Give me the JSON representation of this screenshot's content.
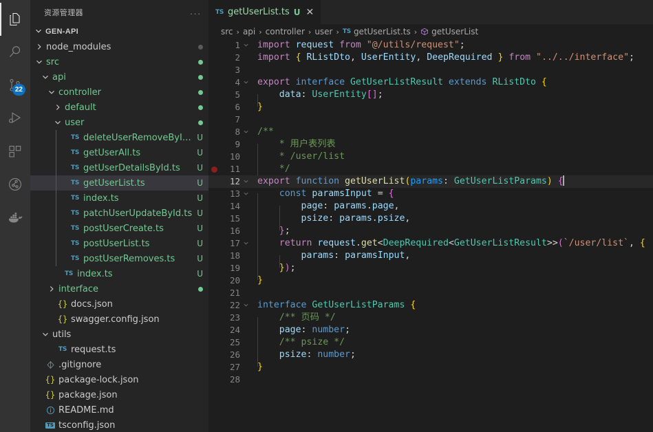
{
  "activitybar": {
    "items": [
      {
        "name": "explorer",
        "icon": "files-icon",
        "active": true,
        "badge": ""
      },
      {
        "name": "search",
        "icon": "search-icon",
        "active": false,
        "badge": ""
      },
      {
        "name": "source-control",
        "icon": "source-control-icon",
        "active": false,
        "badge": "22"
      },
      {
        "name": "run-debug",
        "icon": "run-and-debug-icon",
        "active": false,
        "badge": ""
      },
      {
        "name": "extensions",
        "icon": "extensions-icon",
        "active": false,
        "badge": ""
      },
      {
        "name": "git-graph",
        "icon": "git-graph-icon",
        "active": false,
        "badge": ""
      },
      {
        "name": "docker",
        "icon": "docker-icon",
        "active": false,
        "badge": ""
      }
    ]
  },
  "sidebar": {
    "title": "资源管理器",
    "more_actions": "...",
    "root": {
      "label": "GEN-API",
      "expanded": true
    },
    "tree": [
      {
        "label": "node_modules",
        "type": "folder",
        "expanded": false,
        "indent": 1,
        "deco": "dot",
        "deco_color": "#5a5a5a",
        "color": "#cccccc"
      },
      {
        "label": "src",
        "type": "folder",
        "expanded": true,
        "indent": 1,
        "deco": "dot",
        "deco_color": "#73c991",
        "color": "#73c991"
      },
      {
        "label": "api",
        "type": "folder",
        "expanded": true,
        "indent": 2,
        "deco": "dot",
        "deco_color": "#73c991",
        "color": "#73c991"
      },
      {
        "label": "controller",
        "type": "folder",
        "expanded": true,
        "indent": 3,
        "deco": "dot",
        "deco_color": "#73c991",
        "color": "#73c991"
      },
      {
        "label": "default",
        "type": "folder",
        "expanded": false,
        "indent": 4,
        "deco": "dot",
        "deco_color": "#73c991",
        "color": "#73c991"
      },
      {
        "label": "user",
        "type": "folder",
        "expanded": true,
        "indent": 4,
        "deco": "dot",
        "deco_color": "#73c991",
        "color": "#73c991"
      },
      {
        "label": "deleteUserRemoveById.ts",
        "type": "ts",
        "indent": 5,
        "deco": "U",
        "deco_color": "#73c991",
        "color": "#73c991"
      },
      {
        "label": "getUserAll.ts",
        "type": "ts",
        "indent": 5,
        "deco": "U",
        "deco_color": "#73c991",
        "color": "#73c991"
      },
      {
        "label": "getUserDetailsById.ts",
        "type": "ts",
        "indent": 5,
        "deco": "U",
        "deco_color": "#73c991",
        "color": "#73c991"
      },
      {
        "label": "getUserList.ts",
        "type": "ts",
        "indent": 5,
        "deco": "U",
        "deco_color": "#73c991",
        "color": "#73c991",
        "selected": true
      },
      {
        "label": "index.ts",
        "type": "ts",
        "indent": 5,
        "deco": "U",
        "deco_color": "#73c991",
        "color": "#73c991"
      },
      {
        "label": "patchUserUpdateById.ts",
        "type": "ts",
        "indent": 5,
        "deco": "U",
        "deco_color": "#73c991",
        "color": "#73c991"
      },
      {
        "label": "postUserCreate.ts",
        "type": "ts",
        "indent": 5,
        "deco": "U",
        "deco_color": "#73c991",
        "color": "#73c991"
      },
      {
        "label": "postUserList.ts",
        "type": "ts",
        "indent": 5,
        "deco": "U",
        "deco_color": "#73c991",
        "color": "#73c991"
      },
      {
        "label": "postUserRemoves.ts",
        "type": "ts",
        "indent": 5,
        "deco": "U",
        "deco_color": "#73c991",
        "color": "#73c991"
      },
      {
        "label": "index.ts",
        "type": "ts",
        "indent": 4,
        "deco": "U",
        "deco_color": "#73c991",
        "color": "#73c991"
      },
      {
        "label": "interface",
        "type": "folder",
        "expanded": false,
        "indent": 3,
        "deco": "dot",
        "deco_color": "#73c991",
        "color": "#73c991"
      },
      {
        "label": "docs.json",
        "type": "json",
        "indent": 3,
        "deco": "",
        "deco_color": "",
        "color": "#cccccc"
      },
      {
        "label": "swagger.config.json",
        "type": "json",
        "indent": 3,
        "deco": "",
        "deco_color": "",
        "color": "#cccccc"
      },
      {
        "label": "utils",
        "type": "folder",
        "expanded": true,
        "indent": 2,
        "deco": "",
        "deco_color": "",
        "color": "#cccccc"
      },
      {
        "label": "request.ts",
        "type": "ts",
        "indent": 3,
        "deco": "",
        "deco_color": "",
        "color": "#cccccc"
      },
      {
        "label": ".gitignore",
        "type": "gitignore",
        "indent": 1,
        "deco": "",
        "deco_color": "",
        "color": "#cccccc"
      },
      {
        "label": "package-lock.json",
        "type": "json",
        "indent": 1,
        "deco": "",
        "deco_color": "",
        "color": "#cccccc"
      },
      {
        "label": "package.json",
        "type": "json",
        "indent": 1,
        "deco": "",
        "deco_color": "",
        "color": "#cccccc"
      },
      {
        "label": "README.md",
        "type": "readme",
        "indent": 1,
        "deco": "",
        "deco_color": "",
        "color": "#cccccc"
      },
      {
        "label": "tsconfig.json",
        "type": "tsconfig",
        "indent": 1,
        "deco": "",
        "deco_color": "",
        "color": "#cccccc"
      }
    ]
  },
  "editor": {
    "tab": {
      "icon": "ts-file-icon",
      "filename": "getUserList.ts",
      "git_status": "U",
      "close": "✕"
    },
    "breadcrumb": [
      {
        "label": "src",
        "icon": ""
      },
      {
        "label": "api",
        "icon": ""
      },
      {
        "label": "controller",
        "icon": ""
      },
      {
        "label": "user",
        "icon": ""
      },
      {
        "label": "getUserList.ts",
        "icon": "ts-file-icon"
      },
      {
        "label": "getUserList",
        "icon": "symbol-function-icon"
      }
    ],
    "breadcrumb_separator": "›",
    "active_line": 12,
    "breakpoint_line": 11,
    "lines": [
      {
        "n": 1,
        "fold": "v",
        "tokens": [
          {
            "t": "import ",
            "c": "t-kw"
          },
          {
            "t": "request",
            "c": "t-var"
          },
          {
            "t": " from ",
            "c": "t-kw"
          },
          {
            "t": "\"@/utils/request\"",
            "c": "t-str"
          },
          {
            "t": ";",
            "c": "t-pl"
          }
        ]
      },
      {
        "n": 2,
        "fold": "",
        "tokens": [
          {
            "t": "import ",
            "c": "t-kw"
          },
          {
            "t": "{",
            "c": "t-y"
          },
          {
            "t": " ",
            "c": "t-pl"
          },
          {
            "t": "RListDto",
            "c": "t-var"
          },
          {
            "t": ", ",
            "c": "t-pl"
          },
          {
            "t": "UserEntity",
            "c": "t-var"
          },
          {
            "t": ", ",
            "c": "t-pl"
          },
          {
            "t": "DeepRequired",
            "c": "t-var"
          },
          {
            "t": " ",
            "c": "t-pl"
          },
          {
            "t": "}",
            "c": "t-y"
          },
          {
            "t": " from ",
            "c": "t-kw"
          },
          {
            "t": "\"../../interface\"",
            "c": "t-str"
          },
          {
            "t": ";",
            "c": "t-pl"
          }
        ]
      },
      {
        "n": 3,
        "fold": "",
        "tokens": []
      },
      {
        "n": 4,
        "fold": "v",
        "tokens": [
          {
            "t": "export ",
            "c": "t-kw"
          },
          {
            "t": "interface ",
            "c": "t-ctl"
          },
          {
            "t": "GetUserListResult",
            "c": "t-type"
          },
          {
            "t": " extends ",
            "c": "t-ctl"
          },
          {
            "t": "RListDto",
            "c": "t-type"
          },
          {
            "t": " ",
            "c": "t-pl"
          },
          {
            "t": "{",
            "c": "t-y"
          }
        ]
      },
      {
        "n": 5,
        "fold": "",
        "indent": 1,
        "tokens": [
          {
            "t": "data",
            "c": "t-var"
          },
          {
            "t": ": ",
            "c": "t-pl"
          },
          {
            "t": "UserEntity",
            "c": "t-type"
          },
          {
            "t": "[]",
            "c": "t-p"
          },
          {
            "t": ";",
            "c": "t-pl"
          }
        ]
      },
      {
        "n": 6,
        "fold": "",
        "tokens": [
          {
            "t": "}",
            "c": "t-y"
          }
        ]
      },
      {
        "n": 7,
        "fold": "",
        "tokens": []
      },
      {
        "n": 8,
        "fold": "v",
        "tokens": [
          {
            "t": "/**",
            "c": "t-com"
          }
        ]
      },
      {
        "n": 9,
        "fold": "",
        "indent": 1,
        "tokens": [
          {
            "t": "* 用户表列表",
            "c": "t-com"
          }
        ]
      },
      {
        "n": 10,
        "fold": "",
        "indent": 1,
        "tokens": [
          {
            "t": "* /user/list",
            "c": "t-com"
          }
        ]
      },
      {
        "n": 11,
        "fold": "",
        "indent": 1,
        "tokens": [
          {
            "t": "*/",
            "c": "t-com"
          }
        ]
      },
      {
        "n": 12,
        "fold": "v",
        "tokens": [
          {
            "t": "export ",
            "c": "t-kw"
          },
          {
            "t": "function ",
            "c": "t-ctl"
          },
          {
            "t": "getUserList",
            "c": "t-fn"
          },
          {
            "t": "(",
            "c": "t-y"
          },
          {
            "t": "params",
            "c": "t-b"
          },
          {
            "t": ": ",
            "c": "t-pl"
          },
          {
            "t": "GetUserListParams",
            "c": "t-type"
          },
          {
            "t": ")",
            "c": "t-y"
          },
          {
            "t": " ",
            "c": "t-pl"
          },
          {
            "t": "{",
            "c": "t-p"
          }
        ],
        "cursor": true
      },
      {
        "n": 13,
        "fold": "v",
        "indent": 1,
        "tokens": [
          {
            "t": "const ",
            "c": "t-ctl"
          },
          {
            "t": "paramsInput",
            "c": "t-var"
          },
          {
            "t": " = ",
            "c": "t-pl"
          },
          {
            "t": "{",
            "c": "t-p"
          }
        ]
      },
      {
        "n": 14,
        "fold": "",
        "indent": 2,
        "tokens": [
          {
            "t": "page",
            "c": "t-var"
          },
          {
            "t": ": ",
            "c": "t-pl"
          },
          {
            "t": "params",
            "c": "t-var"
          },
          {
            "t": ".",
            "c": "t-pl"
          },
          {
            "t": "page",
            "c": "t-var"
          },
          {
            "t": ",",
            "c": "t-pl"
          }
        ]
      },
      {
        "n": 15,
        "fold": "",
        "indent": 2,
        "tokens": [
          {
            "t": "psize",
            "c": "t-var"
          },
          {
            "t": ": ",
            "c": "t-pl"
          },
          {
            "t": "params",
            "c": "t-var"
          },
          {
            "t": ".",
            "c": "t-pl"
          },
          {
            "t": "psize",
            "c": "t-var"
          },
          {
            "t": ",",
            "c": "t-pl"
          }
        ]
      },
      {
        "n": 16,
        "fold": "",
        "indent": 1,
        "tokens": [
          {
            "t": "}",
            "c": "t-p"
          },
          {
            "t": ";",
            "c": "t-pl"
          }
        ]
      },
      {
        "n": 17,
        "fold": "v",
        "indent": 1,
        "tokens": [
          {
            "t": "return ",
            "c": "t-kw"
          },
          {
            "t": "request",
            "c": "t-var"
          },
          {
            "t": ".",
            "c": "t-pl"
          },
          {
            "t": "get",
            "c": "t-fn"
          },
          {
            "t": "<",
            "c": "t-pl"
          },
          {
            "t": "DeepRequired",
            "c": "t-type"
          },
          {
            "t": "<",
            "c": "t-pl"
          },
          {
            "t": "GetUserListResult",
            "c": "t-type"
          },
          {
            "t": ">>",
            "c": "t-pl"
          },
          {
            "t": "(",
            "c": "t-p"
          },
          {
            "t": "`/user/list`",
            "c": "t-str"
          },
          {
            "t": ", ",
            "c": "t-pl"
          },
          {
            "t": "{",
            "c": "t-y"
          }
        ]
      },
      {
        "n": 18,
        "fold": "",
        "indent": 2,
        "tokens": [
          {
            "t": "params",
            "c": "t-var"
          },
          {
            "t": ": ",
            "c": "t-pl"
          },
          {
            "t": "paramsInput",
            "c": "t-var"
          },
          {
            "t": ",",
            "c": "t-pl"
          }
        ]
      },
      {
        "n": 19,
        "fold": "",
        "indent": 1,
        "tokens": [
          {
            "t": "}",
            "c": "t-y"
          },
          {
            "t": ")",
            "c": "t-p"
          },
          {
            "t": ";",
            "c": "t-pl"
          }
        ]
      },
      {
        "n": 20,
        "fold": "",
        "tokens": [
          {
            "t": "}",
            "c": "t-y"
          }
        ]
      },
      {
        "n": 21,
        "fold": "",
        "tokens": []
      },
      {
        "n": 22,
        "fold": "v",
        "tokens": [
          {
            "t": "interface ",
            "c": "t-ctl"
          },
          {
            "t": "GetUserListParams",
            "c": "t-type"
          },
          {
            "t": " ",
            "c": "t-pl"
          },
          {
            "t": "{",
            "c": "t-y"
          }
        ]
      },
      {
        "n": 23,
        "fold": "",
        "indent": 1,
        "tokens": [
          {
            "t": "/** 页码 */",
            "c": "t-com"
          }
        ]
      },
      {
        "n": 24,
        "fold": "",
        "indent": 1,
        "tokens": [
          {
            "t": "page",
            "c": "t-var"
          },
          {
            "t": ": ",
            "c": "t-pl"
          },
          {
            "t": "number",
            "c": "t-ctl"
          },
          {
            "t": ";",
            "c": "t-pl"
          }
        ]
      },
      {
        "n": 25,
        "fold": "",
        "indent": 1,
        "tokens": [
          {
            "t": "/** psize */",
            "c": "t-com"
          }
        ]
      },
      {
        "n": 26,
        "fold": "",
        "indent": 1,
        "tokens": [
          {
            "t": "psize",
            "c": "t-var"
          },
          {
            "t": ": ",
            "c": "t-pl"
          },
          {
            "t": "number",
            "c": "t-ctl"
          },
          {
            "t": ";",
            "c": "t-pl"
          }
        ]
      },
      {
        "n": 27,
        "fold": "",
        "tokens": [
          {
            "t": "}",
            "c": "t-y"
          }
        ]
      },
      {
        "n": 28,
        "fold": "",
        "tokens": []
      }
    ]
  }
}
